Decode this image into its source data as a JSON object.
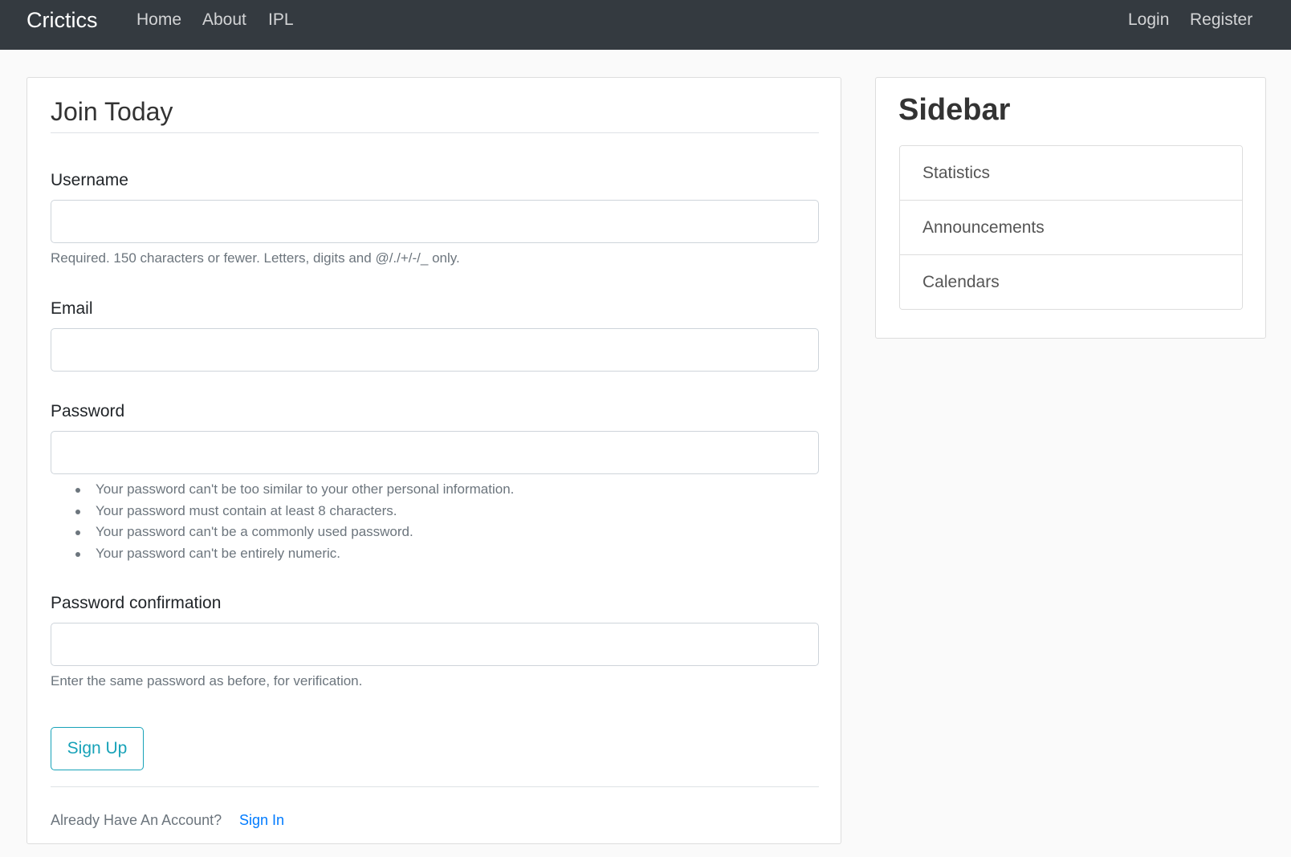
{
  "navbar": {
    "brand": "Crictics",
    "links": [
      "Home",
      "About",
      "IPL"
    ],
    "right_links": [
      "Login",
      "Register"
    ],
    "background": "#343a40"
  },
  "form": {
    "legend": "Join Today",
    "username": {
      "label": "Username",
      "value": "",
      "help": "Required. 150 characters or fewer. Letters, digits and @/./+/-/_ only."
    },
    "email": {
      "label": "Email",
      "value": ""
    },
    "password": {
      "label": "Password",
      "value": "",
      "rules": [
        "Your password can't be too similar to your other personal information.",
        "Your password must contain at least 8 characters.",
        "Your password can't be a commonly used password.",
        "Your password can't be entirely numeric."
      ]
    },
    "password_confirmation": {
      "label": "Password confirmation",
      "value": "",
      "help": "Enter the same password as before, for verification."
    },
    "submit_label": "Sign Up",
    "account_prompt": "Already Have An Account?",
    "signin_label": "Sign In",
    "accent_color": "#17a2b8",
    "link_color": "#007bff"
  },
  "sidebar": {
    "title": "Sidebar",
    "items": [
      "Statistics",
      "Announcements",
      "Calendars"
    ]
  }
}
